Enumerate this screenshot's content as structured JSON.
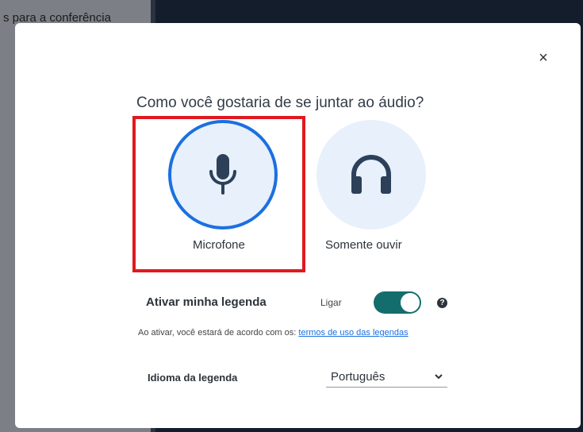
{
  "background": {
    "top_text": "s para a conferência"
  },
  "dialog": {
    "title": "Como você gostaria de se juntar ao áudio?",
    "close_label": "×",
    "options": [
      {
        "label": "Microfone",
        "icon": "microphone-icon",
        "selected": true
      },
      {
        "label": "Somente ouvir",
        "icon": "headphones-icon",
        "selected": false
      }
    ],
    "captions": {
      "label": "Ativar minha legenda",
      "toggle_text": "Ligar",
      "toggle_on": true,
      "help": "?",
      "terms_prefix": "Ao ativar, você estará de acordo com os: ",
      "terms_link": "termos de uso das legendas"
    },
    "language": {
      "label": "Idioma da legenda",
      "value": "Português"
    }
  },
  "colors": {
    "accent": "#1b70e0",
    "toggle": "#136d6d",
    "highlight": "#e0191f",
    "option_bg": "#e7f0fb"
  }
}
